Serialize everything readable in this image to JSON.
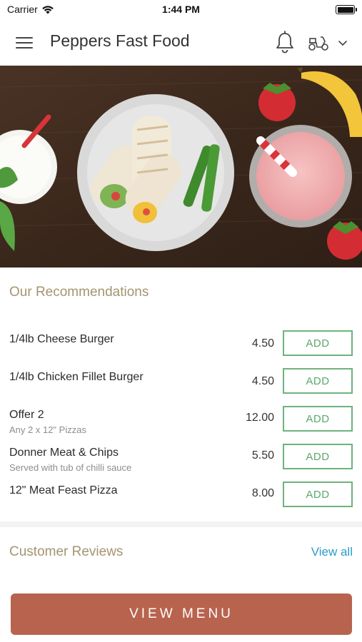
{
  "status_bar": {
    "carrier": "Carrier",
    "time": "1:44 PM"
  },
  "header": {
    "title": "Peppers Fast Food",
    "icons": [
      "menu-icon",
      "bell-icon",
      "scooter-icon",
      "chevron-down-icon"
    ]
  },
  "recommendations": {
    "title": "Our Recommendations",
    "items": [
      {
        "name": "1/4lb Cheese Burger",
        "description": "",
        "price": "4.50",
        "add_label": "ADD"
      },
      {
        "name": "1/4lb Chicken Fillet Burger",
        "description": "",
        "price": "4.50",
        "add_label": "ADD"
      },
      {
        "name": "Offer 2",
        "description": "Any 2 x 12\" Pizzas",
        "price": "12.00",
        "add_label": "ADD"
      },
      {
        "name": "Donner Meat & Chips",
        "description": "Served with tub of chilli sauce",
        "price": "5.50",
        "add_label": "ADD"
      },
      {
        "name": "12\" Meat Feast Pizza",
        "description": "",
        "price": "8.00",
        "add_label": "ADD"
      }
    ]
  },
  "reviews": {
    "title": "Customer Reviews",
    "view_all_label": "View all"
  },
  "footer": {
    "view_menu_label": "VIEW MENU"
  },
  "colors": {
    "accent_title": "#a5946f",
    "add_green": "#5aa86b",
    "link_blue": "#2b9bc9",
    "primary_button": "#b8634e"
  }
}
